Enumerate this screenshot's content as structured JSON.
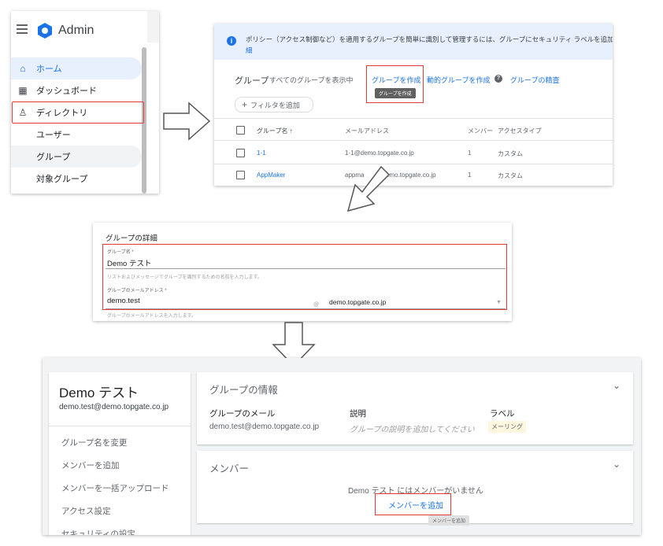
{
  "panel1": {
    "app_title": "Admin",
    "nav": [
      {
        "label": "ホーム",
        "icon": "home-icon"
      },
      {
        "label": "ダッシュボード",
        "icon": "dashboard-icon"
      },
      {
        "label": "ディレクトリ",
        "icon": "person-icon"
      },
      {
        "label": "ユーザー"
      },
      {
        "label": "グループ"
      },
      {
        "label": "対象グループ"
      }
    ]
  },
  "panel2": {
    "info_text": "ポリシー（アクセス制御など）を適用するグループを簡単に識別して管理するには、グループにセキュリティ ラベルを追加しま",
    "info_text_2": "細",
    "group_title": "グループ",
    "group_sub": "すべてのグループを表示中",
    "create_group": "グループを作成",
    "tooltip": "グループを作成",
    "create_dynamic": "動的グループを作成",
    "inspect": "グループの精査",
    "filter": "フィルタを追加",
    "columns": [
      "グループ名 ↑",
      "メールアドレス",
      "メンバー",
      "アクセスタイプ"
    ],
    "rows": [
      {
        "name": "1-1",
        "email": "1-1@demo.topgate.co.jp",
        "members": "1",
        "type": "カスタム"
      },
      {
        "name": "AppMaker",
        "email": "appma",
        "email_rest": "emo.topgate.co.jp",
        "members": "1",
        "type": "カスタム"
      }
    ]
  },
  "panel3": {
    "title": "グループの詳細",
    "name_label": "グループ名 *",
    "name_value": "Demo テスト",
    "name_hint": "リストおよびメッセージでグループを識別するための名前を入力します。",
    "email_label": "グループのメールアドレス *",
    "email_value": "demo.test",
    "at": "@",
    "domain": "demo.topgate.co.jp",
    "email_hint": "グループのメールアドレスを入力します。"
  },
  "panel4": {
    "group_name": "Demo テスト",
    "group_email": "demo.test@demo.topgate.co.jp",
    "menu": [
      "グループ名を変更",
      "メンバーを追加",
      "メンバーを一括アップロード",
      "アクセス設定",
      "セキュリティの設定"
    ],
    "info_title": "グループの情報",
    "email_header": "グループのメール",
    "email_value": "demo.test@demo.topgate.co.jp",
    "desc_header": "説明",
    "desc_placeholder": "グループの説明を追加してください",
    "label_header": "ラベル",
    "label_value": "メーリング",
    "members_title": "メンバー",
    "no_members": "Demo テスト にはメンバーがいません",
    "add_member": "メンバーを追加",
    "add_member_tooltip": "メンバーを追加"
  },
  "colors": {
    "accent": "#1a73e8",
    "highlight": "#e53935",
    "nav_active": "#e8f0fe",
    "label_chip": "#fef7e0"
  }
}
